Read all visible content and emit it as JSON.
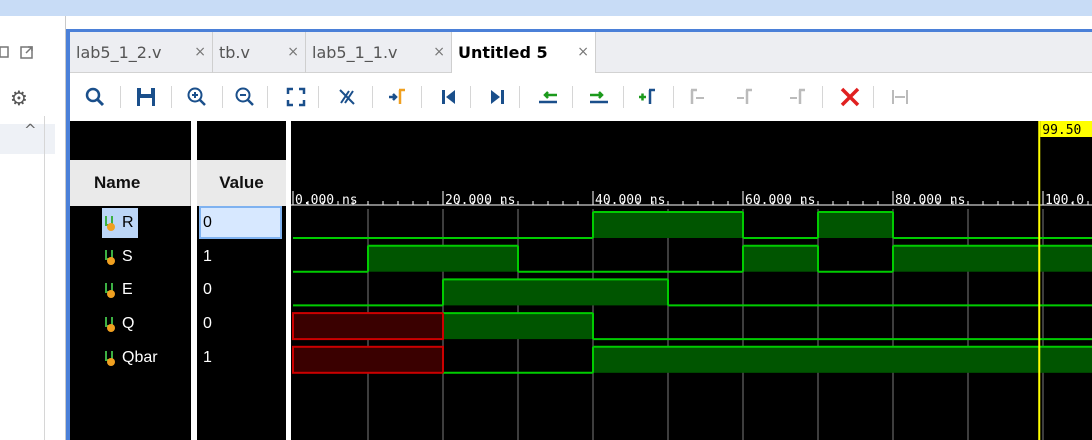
{
  "tabs": [
    {
      "label": "lab5_1_2.v",
      "close": "×"
    },
    {
      "label": "tb.v",
      "close": "×"
    },
    {
      "label": "lab5_1_1.v",
      "close": "×"
    },
    {
      "label": "Untitled 5",
      "close": "×"
    }
  ],
  "toolbar": {
    "buttons": [
      "search-icon",
      "save-icon",
      "zoom-in-icon",
      "zoom-out-icon",
      "zoom-fit-icon",
      "cursor-icon",
      "go-to-time-icon",
      "go-to-start-icon",
      "go-to-end-icon",
      "previous-transition-icon",
      "next-transition-icon",
      "add-marker-icon",
      "previous-marker-icon",
      "next-marker-icon",
      "snap-marker-icon",
      "delete-icon",
      "swap-cursors-icon"
    ],
    "delete_color": "#e02020"
  },
  "columns": {
    "name": "Name",
    "value": "Value"
  },
  "signals": [
    {
      "name": "R",
      "value": "0"
    },
    {
      "name": "S",
      "value": "1"
    },
    {
      "name": "E",
      "value": "0"
    },
    {
      "name": "Q",
      "value": "0"
    },
    {
      "name": "Qbar",
      "value": "1"
    }
  ],
  "timeline": {
    "ticks": [
      "0.000 ns",
      "20.000 ns",
      "40.000 ns",
      "60.000 ns",
      "80.000 ns",
      "100.0"
    ],
    "cursor_label": "99.50",
    "cursor_color": "#ffff00",
    "wave_color": "#00cc00",
    "unknown_color": "#cc0000"
  },
  "waveforms": {
    "unit_ns": 10,
    "R": [
      [
        0,
        0
      ],
      [
        40,
        1
      ],
      [
        60,
        0
      ],
      [
        70,
        1
      ],
      [
        80,
        0
      ]
    ],
    "S": [
      [
        0,
        0
      ],
      [
        10,
        1
      ],
      [
        30,
        0
      ],
      [
        60,
        1
      ],
      [
        70,
        0
      ],
      [
        80,
        1
      ]
    ],
    "E": [
      [
        0,
        0
      ],
      [
        20,
        1
      ],
      [
        50,
        0
      ]
    ],
    "Q": [
      [
        0,
        "x"
      ],
      [
        20,
        1
      ],
      [
        40,
        0
      ]
    ],
    "Qbar": [
      [
        0,
        "x"
      ],
      [
        20,
        0
      ],
      [
        40,
        1
      ]
    ]
  }
}
